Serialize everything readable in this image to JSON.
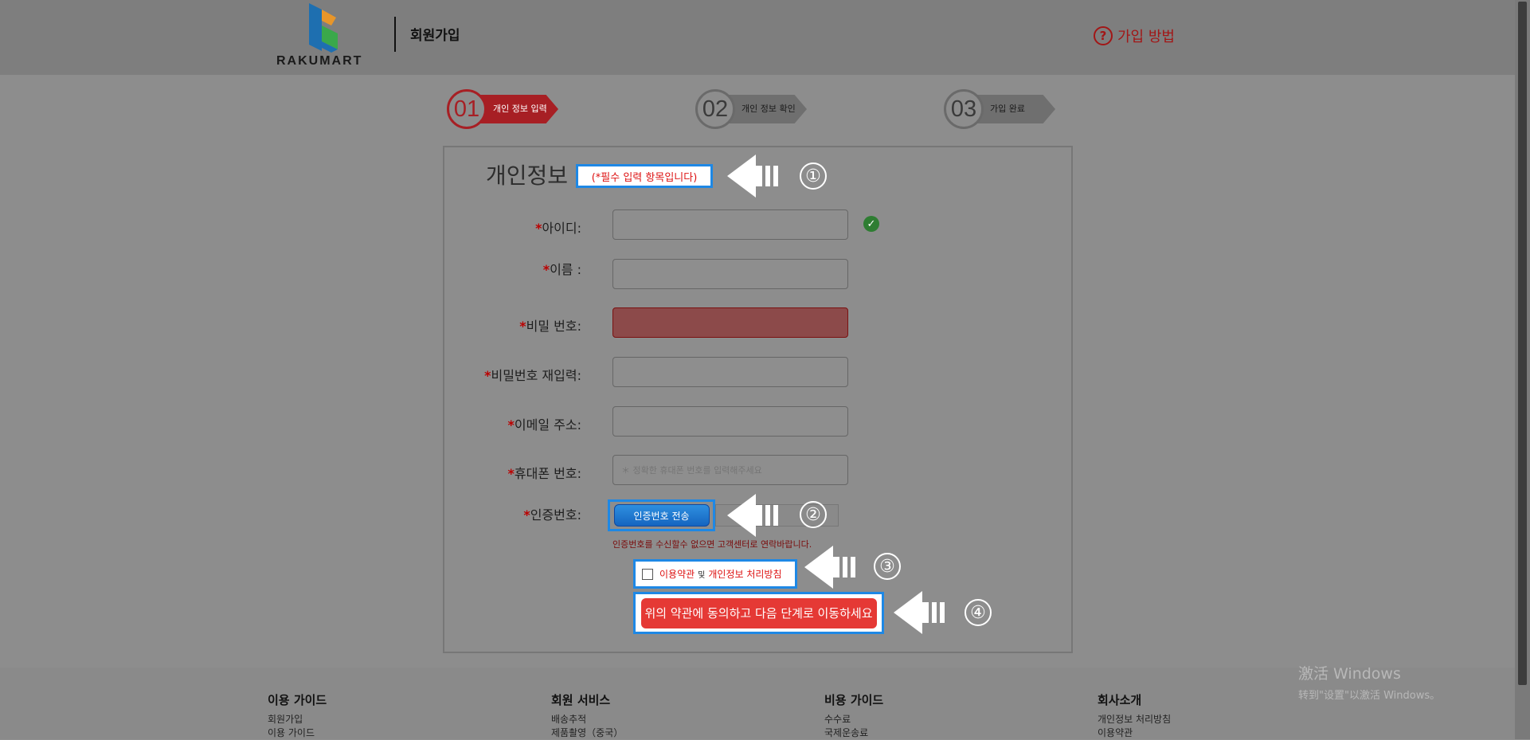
{
  "header": {
    "logo_text_a": "RAKU",
    "logo_text_b": "MART",
    "title": "회원가입",
    "help_label": "가입 방법"
  },
  "steps": [
    {
      "number": "01",
      "label": "개인 정보 입력",
      "active": true
    },
    {
      "number": "02",
      "label": "개인 정보 확인",
      "active": false
    },
    {
      "number": "03",
      "label": "가입 완료",
      "active": false
    }
  ],
  "form": {
    "title": "개인정보",
    "required_note": "(*필수 입력 항목입니다)",
    "star": "*",
    "fields": {
      "id": {
        "label": "아이디:",
        "value": ""
      },
      "name": {
        "label": "이름 :",
        "value": ""
      },
      "password": {
        "label": "비밀 번호:",
        "value": ""
      },
      "password_confirm": {
        "label": "비밀번호 재입력:",
        "value": ""
      },
      "email": {
        "label": "이메일 주소:",
        "value": ""
      },
      "phone": {
        "label": "휴대폰 번호:",
        "placeholder": "＊ 정확한 휴대폰 번호를 입력해주세요"
      },
      "verify": {
        "label": "인증번호:"
      }
    },
    "verify_button": "인증번호 전송",
    "verify_note": "인증번호를 수신할수 없으면 고객센터로 연락바랍니다.",
    "terms": {
      "terms_link": "이용약관",
      "and": "및",
      "privacy_link": "개인정보 처리방침",
      "checked": false
    },
    "agree_button": "위의 약관에 동의하고 다음 단계로 이동하세요"
  },
  "annotations": [
    "①",
    "②",
    "③",
    "④"
  ],
  "footer": {
    "columns": [
      {
        "title": "이용 가이드",
        "links": [
          "회원가입",
          "이용 가이드"
        ]
      },
      {
        "title": "회원 서비스",
        "links": [
          "배송추적",
          "제품촬영（중국）"
        ]
      },
      {
        "title": "비용 가이드",
        "links": [
          "수수료",
          "국제운송료"
        ]
      },
      {
        "title": "회사소개",
        "links": [
          "개인정보 처리방침",
          "이용약관"
        ]
      }
    ]
  },
  "watermark": {
    "line1": "激活 Windows",
    "line2": "转到\"设置\"以激活 Windows。"
  },
  "colors": {
    "accent_red": "#a71f24",
    "highlight_blue": "#1e88e5",
    "button_red": "#e53935"
  }
}
